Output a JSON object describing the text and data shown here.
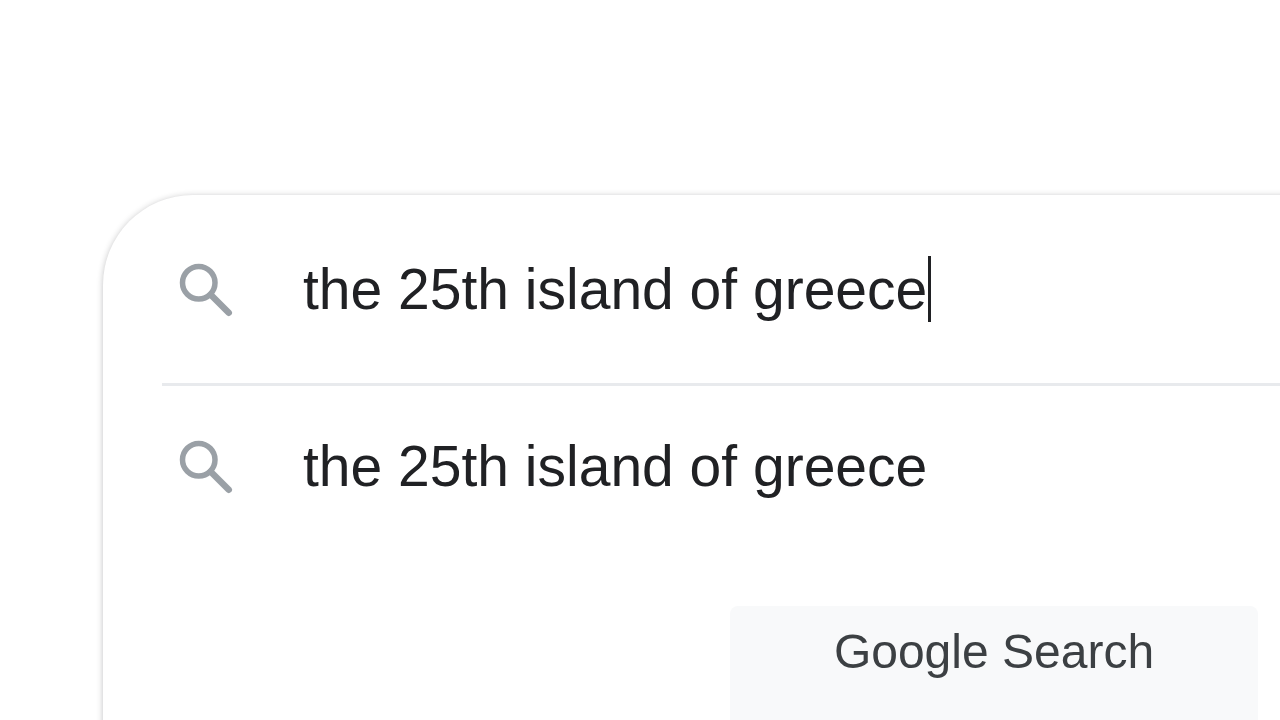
{
  "search": {
    "value": "the 25th island of greece",
    "focused": true
  },
  "suggestions": [
    {
      "text": "the 25th island of greece"
    }
  ],
  "buttons": [
    {
      "label": "Google Search"
    }
  ]
}
